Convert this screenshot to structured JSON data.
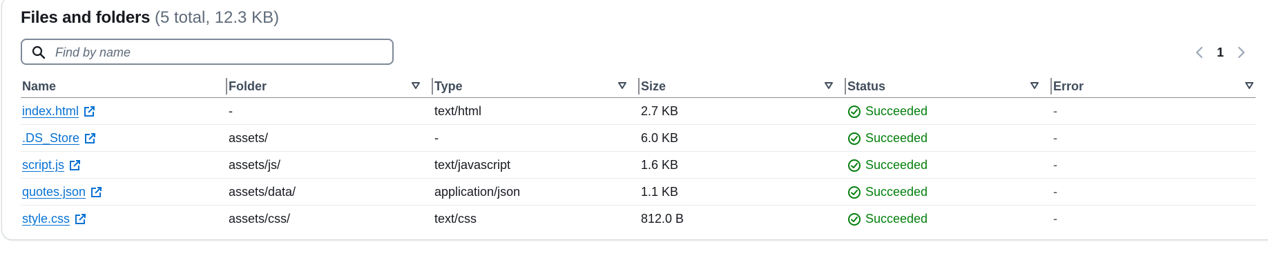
{
  "header": {
    "title": "Files and folders",
    "counter": "(5 total, 12.3 KB)"
  },
  "search": {
    "placeholder": "Find by name",
    "value": "",
    "icon": "search-icon"
  },
  "pagination": {
    "current_page": "1",
    "prev_icon": "chevron-left-icon",
    "next_icon": "chevron-right-icon"
  },
  "table": {
    "columns": [
      {
        "label": "Name",
        "filter_icon": ""
      },
      {
        "label": "Folder",
        "filter_icon": "sort-caret-icon"
      },
      {
        "label": "Type",
        "filter_icon": "sort-caret-icon"
      },
      {
        "label": "Size",
        "filter_icon": "sort-caret-icon"
      },
      {
        "label": "Status",
        "filter_icon": "sort-caret-icon"
      },
      {
        "label": "Error",
        "filter_icon": "sort-caret-icon"
      }
    ],
    "rows": [
      {
        "name": "index.html",
        "folder": "-",
        "type": "text/html",
        "size": "2.7 KB",
        "status": "Succeeded",
        "error": "-"
      },
      {
        "name": ".DS_Store",
        "folder": "assets/",
        "type": "-",
        "size": "6.0 KB",
        "status": "Succeeded",
        "error": "-"
      },
      {
        "name": "script.js",
        "folder": "assets/js/",
        "type": "text/javascript",
        "size": "1.6 KB",
        "status": "Succeeded",
        "error": "-"
      },
      {
        "name": "quotes.json",
        "folder": "assets/data/",
        "type": "application/json",
        "size": "1.1 KB",
        "status": "Succeeded",
        "error": "-"
      },
      {
        "name": "style.css",
        "folder": "assets/css/",
        "type": "text/css",
        "size": "812.0 B",
        "status": "Succeeded",
        "error": "-"
      }
    ]
  },
  "colors": {
    "link": "#0972d3",
    "success": "#037f0c",
    "border": "#7d8998"
  }
}
